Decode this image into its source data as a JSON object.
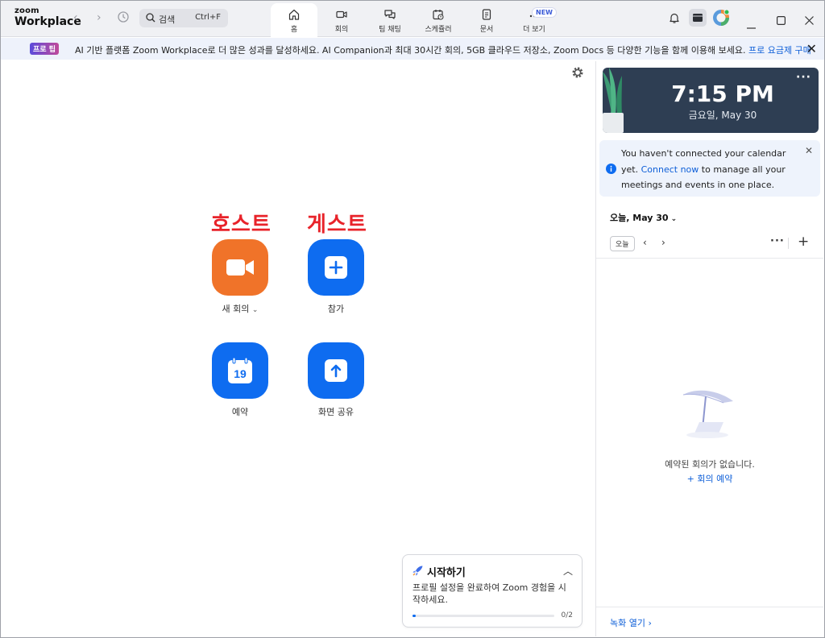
{
  "app": {
    "logo_line1": "zoom",
    "logo_line2": "Workplace"
  },
  "search": {
    "placeholder": "검색",
    "shortcut": "Ctrl+F"
  },
  "tabs": [
    {
      "label": "홈",
      "icon": "home-icon",
      "active": true
    },
    {
      "label": "회의",
      "icon": "video-camera-icon"
    },
    {
      "label": "팀 채팅",
      "icon": "chat-bubbles-icon"
    },
    {
      "label": "스케쥴러",
      "icon": "calendar-clock-icon"
    },
    {
      "label": "문서",
      "icon": "document-icon"
    },
    {
      "label": "더 보기",
      "icon": "more-dots-icon",
      "badge": "NEW"
    }
  ],
  "promo": {
    "tag": "프로 팁",
    "text": "AI 기반 플랫폼 Zoom Workplace로 더 많은 성과를 달성하세요. AI Companion과 최대 30시간 회의, 5GB 클라우드 저장소, Zoom Docs 등 다양한 기능을 함께 이용해 보세요.",
    "link": "프로 요금제 구매"
  },
  "annotations": {
    "host": "호스트",
    "guest": "게스트"
  },
  "actions": [
    {
      "label": "새 회의",
      "icon": "video-camera-icon",
      "color": "#f07329"
    },
    {
      "label": "참가",
      "icon": "plus-icon",
      "color": "#0e6cf0"
    },
    {
      "label": "예약",
      "icon": "calendar-icon",
      "color": "#0e6cf0",
      "calendar_day": "19"
    },
    {
      "label": "화면 공유",
      "icon": "share-arrow-icon",
      "color": "#0e6cf0"
    }
  ],
  "getting_started": {
    "title": "시작하기",
    "description": "프로필 설정을 완료하여 Zoom 경험을 시작하세요.",
    "progress": "0/2",
    "progress_fraction": 0.02
  },
  "calendar": {
    "time": "7:15 PM",
    "date": "금요일, May 30",
    "notice_pre": "You haven't connected your calendar yet.",
    "notice_link": "Connect now",
    "notice_post": "to manage all your meetings and events in one place.",
    "today_label": "오늘, May 30",
    "today_button": "오늘",
    "empty_text": "예약된 회의가 없습니다.",
    "schedule_link": "+ 회의 예약",
    "recordings_link": "녹화 열기",
    "more_icon": "ellipsis-icon"
  },
  "colors": {
    "brand_blue": "#0e6cf0",
    "orange": "#f07329",
    "annotation_red": "#e8232a",
    "clock_bg": "#2e3e53"
  }
}
